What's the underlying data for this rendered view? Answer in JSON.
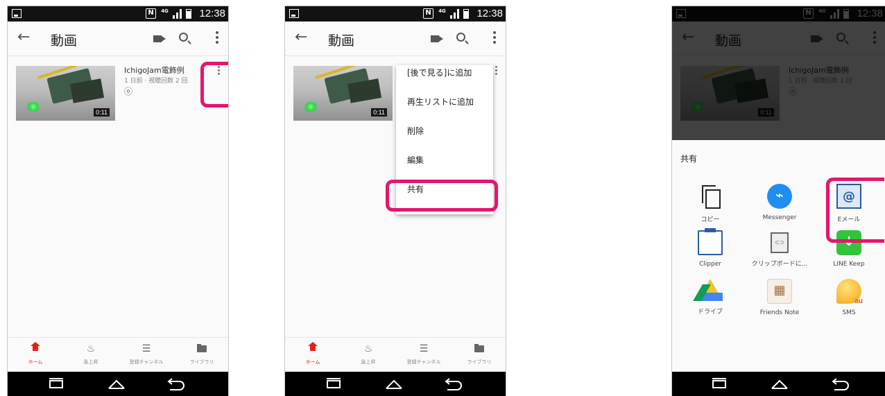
{
  "status": {
    "time": "12:38",
    "nfc": "N",
    "network": "4G"
  },
  "appbar": {
    "title": "動画",
    "back": "←"
  },
  "video": {
    "title": "IchigoJam電飾例",
    "meta": "1 日前 · 視聴回数 2 回",
    "link_icon": "ⓞ",
    "duration": "0:11"
  },
  "bottom_nav": [
    {
      "label": "ホーム",
      "icon": "home-icon",
      "active": true
    },
    {
      "label": "急上昇",
      "icon": "flame-icon",
      "glyph": "♨"
    },
    {
      "label": "登録チャンネル",
      "icon": "subscriptions-icon",
      "glyph": "☰"
    },
    {
      "label": "ライブラリ",
      "icon": "folder-icon"
    }
  ],
  "menu": [
    "[後で見る]に追加",
    "再生リストに追加",
    "削除",
    "編集",
    "共有"
  ],
  "share": {
    "title": "共有",
    "items": [
      {
        "label": "コピー",
        "icon": "copy-icon"
      },
      {
        "label": "Messenger",
        "icon": "messenger-icon"
      },
      {
        "label": "Eメール",
        "icon": "email-icon"
      },
      {
        "label": "Clipper",
        "icon": "clipper-icon"
      },
      {
        "label": "クリップボードに...",
        "icon": "clipboard-icon"
      },
      {
        "label": "LINE Keep",
        "icon": "line-keep-icon"
      },
      {
        "label": "ドライブ",
        "icon": "drive-icon"
      },
      {
        "label": "Friends Note",
        "icon": "friends-note-icon"
      },
      {
        "label": "SMS",
        "icon": "sms-icon"
      }
    ]
  },
  "colors": {
    "accent": "#e62117",
    "highlight": "#e5156d"
  }
}
